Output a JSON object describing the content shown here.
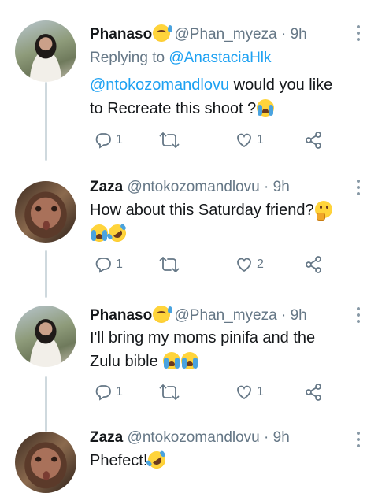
{
  "tweets": [
    {
      "name": "Phanaso",
      "handle": "@Phan_myeza",
      "dot": "·",
      "time": "9h",
      "replying_prefix": "Replying to",
      "replying_to": "@AnastaciaHlk",
      "mention": "@ntokozomandlovu",
      "text_line1": " would you like",
      "text_line2": "to Recreate this shoot ?",
      "replies": "1",
      "retweets": "",
      "likes": "1"
    },
    {
      "name": "Zaza",
      "handle": "@ntokozomandlovu",
      "dot": "·",
      "time": "9h",
      "text_line1": "How about this Saturday friend?",
      "replies": "1",
      "retweets": "",
      "likes": "2"
    },
    {
      "name": "Phanaso",
      "handle": "@Phan_myeza",
      "dot": "·",
      "time": "9h",
      "text_line1": "I'll bring my moms pinifa and the",
      "text_line2": "Zulu bible ",
      "replies": "1",
      "retweets": "",
      "likes": "1"
    },
    {
      "name": "Zaza",
      "handle": "@ntokozomandlovu",
      "dot": "·",
      "time": "9h",
      "text_line1": "Phefect!"
    }
  ],
  "icons": {
    "name_emoji": "sweat-smile-emoji",
    "reply": "reply-icon",
    "retweet": "retweet-icon",
    "like": "heart-icon",
    "share": "share-icon",
    "more": "more-vertical-icon"
  },
  "colors": {
    "link": "#1da1f2",
    "muted": "#657786",
    "thread_line": "#cfd9de"
  }
}
